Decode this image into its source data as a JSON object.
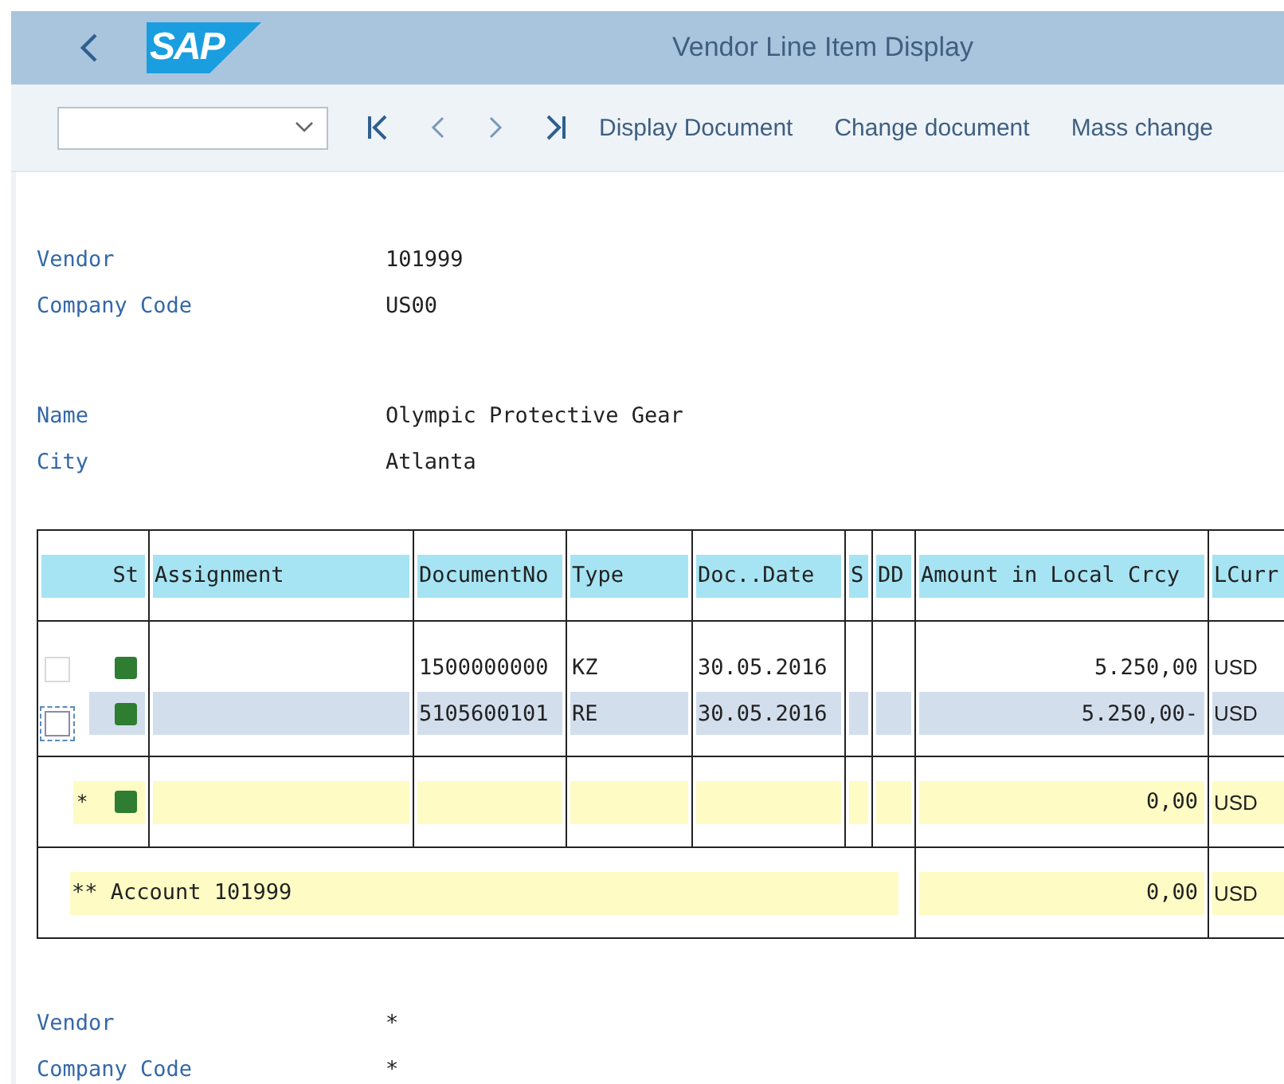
{
  "header": {
    "logo": "SAP",
    "title": "Vendor Line Item Display"
  },
  "toolbar": {
    "actions": [
      "Display Document",
      "Change document",
      "Mass change"
    ]
  },
  "header_fields": [
    [
      {
        "label": "Vendor",
        "value": "101999"
      },
      {
        "label": "Company Code",
        "value": "US00"
      }
    ],
    [
      {
        "label": "Name",
        "value": "Olympic Protective Gear"
      },
      {
        "label": "City",
        "value": "Atlanta"
      }
    ]
  ],
  "table": {
    "columns": [
      "St",
      "Assignment",
      "DocumentNo",
      "Type",
      "Doc..Date",
      "S",
      "DD",
      "Amount in Local Crcy",
      "LCurr"
    ],
    "rows": [
      {
        "kind": "item",
        "checked": false,
        "selected": false,
        "color": "#2e7d32",
        "document_no": "1500000000",
        "type": "KZ",
        "doc_date": "30.05.2016",
        "amount": "5.250,00",
        "currency": "USD"
      },
      {
        "kind": "item",
        "checked": false,
        "selected": true,
        "color": "#2e7d32",
        "document_no": "5105600101",
        "type": "RE",
        "doc_date": "30.05.2016",
        "amount": "5.250,00-",
        "currency": "USD"
      },
      {
        "kind": "subtotal",
        "marker": "*",
        "color": "#2e7d32",
        "amount": "0,00",
        "currency": "USD"
      },
      {
        "kind": "total",
        "label": "** Account 101999",
        "amount": "0,00",
        "currency": "USD"
      }
    ]
  },
  "footer_fields": [
    {
      "label": "Vendor",
      "value": "*"
    },
    {
      "label": "Company Code",
      "value": "*"
    }
  ]
}
